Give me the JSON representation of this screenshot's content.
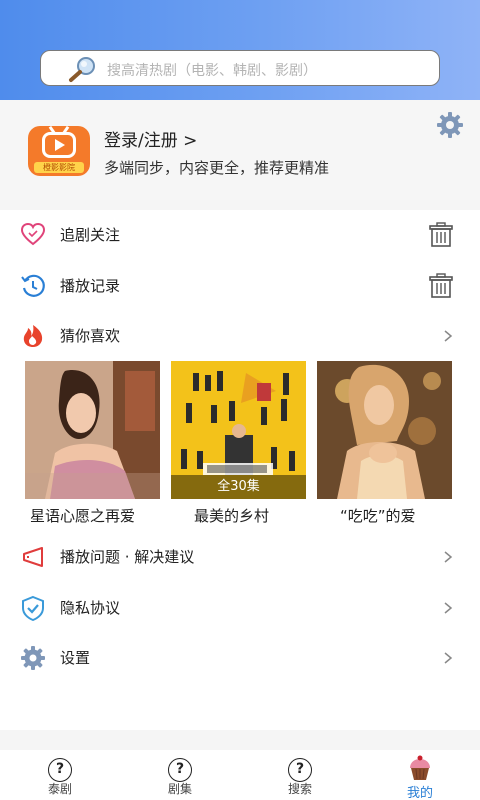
{
  "search": {
    "placeholder": "搜高清热剧（电影、韩剧、影剧）"
  },
  "profile": {
    "logo_tag": "橙影影院",
    "login_label": "登录/注册 >",
    "subtitle": "多端同步，内容更全，推荐更精准"
  },
  "menu": {
    "follow": "追剧关注",
    "history": "播放记录",
    "guess": "猜你喜欢",
    "feedback": "播放问题 · 解决建议",
    "privacy": "隐私协议",
    "settings": "设置"
  },
  "posters": [
    {
      "title": "星语心愿之再爱",
      "badge": ""
    },
    {
      "title": "最美的乡村",
      "badge": "全30集"
    },
    {
      "title": "“吃吃”的爱",
      "badge": ""
    }
  ],
  "tabs": [
    {
      "label": "泰剧",
      "icon": "?"
    },
    {
      "label": "剧集",
      "icon": "?"
    },
    {
      "label": "搜索",
      "icon": "?"
    },
    {
      "label": "我的"
    }
  ],
  "colors": {
    "accent": "#2a7fd5",
    "header_start": "#4f8cec",
    "header_end": "#8fb3f7",
    "logo": "#f47a2a"
  }
}
